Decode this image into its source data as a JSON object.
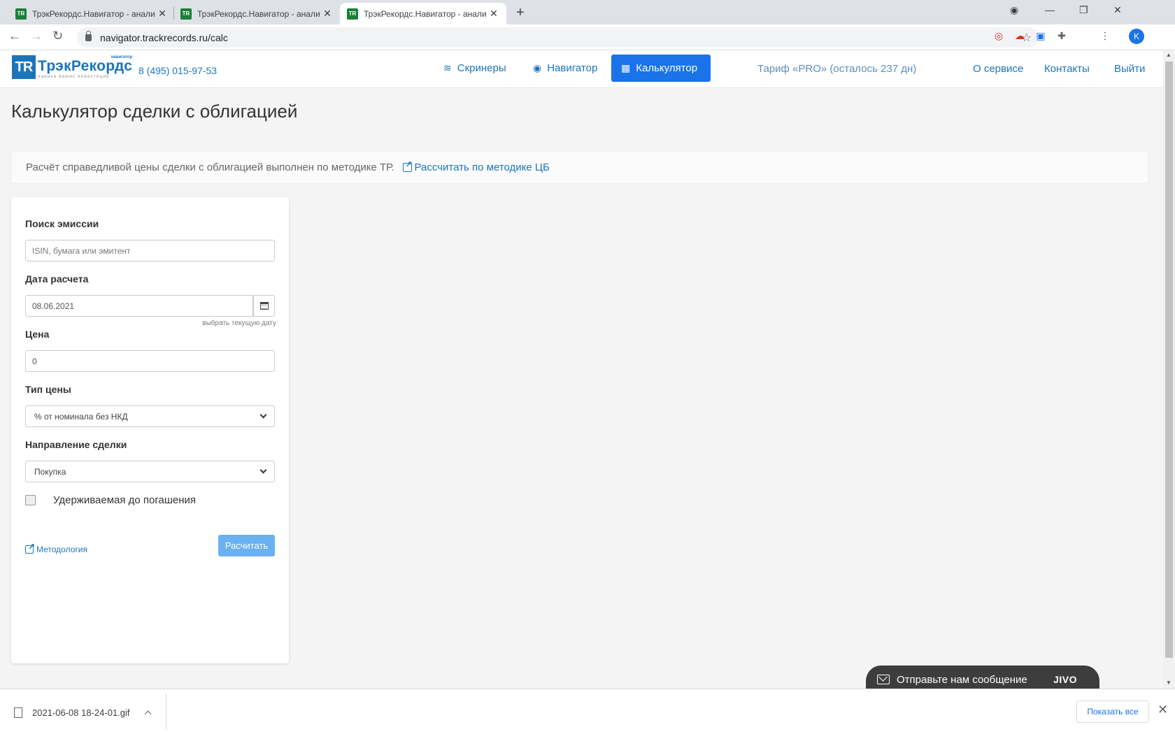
{
  "browser": {
    "tabs": [
      {
        "title": "ТрэкРекордс.Навигатор - анали"
      },
      {
        "title": "ТрэкРекордс.Навигатор - анали"
      },
      {
        "title": "ТрэкРекордс.Навигатор - анали"
      }
    ],
    "favicon_text": "TR",
    "url": "navigator.trackrecords.ru/calc",
    "profile_initial": "K"
  },
  "header": {
    "logo_mark": "TR",
    "logo_name": "ТрэкРекордс",
    "logo_badge": "навигатор",
    "logo_tagline": "оценка ваших инвестиций",
    "phone": "8 (495) 015-97-53",
    "nav": [
      {
        "label": "Скринеры",
        "icon": "layers-icon"
      },
      {
        "label": "Навигатор",
        "icon": "compass-icon"
      },
      {
        "label": "Калькулятор",
        "icon": "calculator-icon",
        "active": true
      }
    ],
    "tariff": "Тариф «PRO» (осталось 237 дн)",
    "links": {
      "about": "О сервисе",
      "contacts": "Контакты",
      "logout": "Выйти"
    }
  },
  "page_title": "Калькулятор сделки с облигацией",
  "notice": {
    "text": "Расчёт справедливой цены сделки с облигацией выполнен по методике ТР.",
    "link": "Рассчитать по методике ЦБ"
  },
  "form": {
    "search": {
      "label": "Поиск эмиссии",
      "placeholder": "ISIN, бумага или эмитент"
    },
    "date": {
      "label": "Дата расчета",
      "value": "08.06.2021",
      "hint": "выбрать текущую дату"
    },
    "price": {
      "label": "Цена",
      "value": "0"
    },
    "price_type": {
      "label": "Тип цены",
      "selected": "% от номинала без НКД"
    },
    "direction": {
      "label": "Направление сделки",
      "selected": "Покупка"
    },
    "held_to_maturity": {
      "label": "Удерживаемая до погашения",
      "checked": false
    },
    "methodology_link": "Методология",
    "submit": "Расчитать"
  },
  "chat": {
    "text": "Отправьте нам сообщение",
    "brand": "JIVO"
  },
  "downloads": {
    "file": "2021-06-08 18-24-01.gif",
    "show_all": "Показать все"
  },
  "colors": {
    "brand": "#1c75bc",
    "active_nav": "#1a73e8",
    "submit": "#6ab1f3"
  }
}
